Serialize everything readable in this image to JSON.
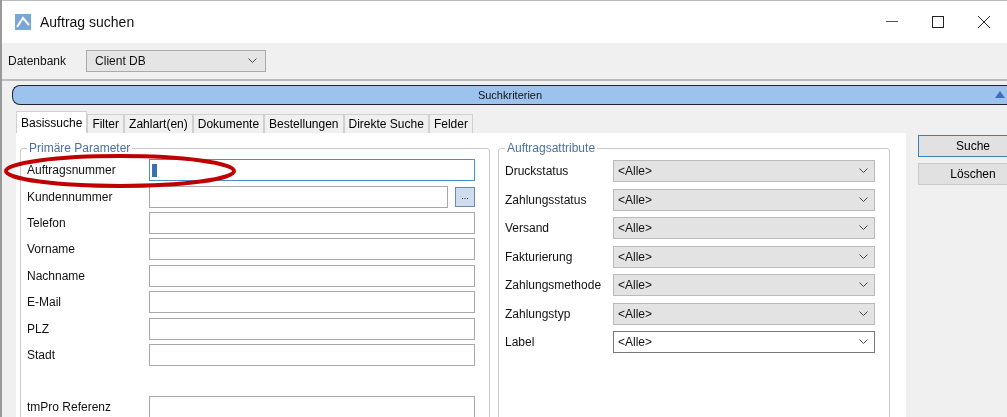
{
  "window": {
    "title": "Auftrag suchen"
  },
  "database": {
    "label": "Datenbank",
    "value": "Client DB"
  },
  "section_bar": {
    "title": "Suchkriterien",
    "expanded": true
  },
  "tabs": [
    {
      "label": "Basissuche",
      "selected": true
    },
    {
      "label": "Filter",
      "selected": false
    },
    {
      "label": "Zahlart(en)",
      "selected": false
    },
    {
      "label": "Dokumente",
      "selected": false
    },
    {
      "label": "Bestellungen",
      "selected": false
    },
    {
      "label": "Direkte Suche",
      "selected": false
    },
    {
      "label": "Felder",
      "selected": false
    }
  ],
  "primary_group": {
    "title": "Primäre Parameter",
    "fields": [
      {
        "label": "Auftragsnummer",
        "focused": true
      },
      {
        "label": "Kundennummer",
        "focused": false,
        "browse_button": "..."
      },
      {
        "label": "Telefon",
        "focused": false
      },
      {
        "label": "Vorname",
        "focused": false
      },
      {
        "label": "Nachname",
        "focused": false
      },
      {
        "label": "E-Mail",
        "focused": false
      },
      {
        "label": "PLZ",
        "focused": false
      },
      {
        "label": "Stadt",
        "focused": false
      },
      {
        "label": "tmPro Referenz",
        "focused": false,
        "spaced": true
      }
    ]
  },
  "attributes_group": {
    "title": "Auftragsattribute",
    "fields": [
      {
        "label": "Druckstatus",
        "value": "<Alle>",
        "disabled": true
      },
      {
        "label": "Zahlungsstatus",
        "value": "<Alle>",
        "disabled": true
      },
      {
        "label": "Versand",
        "value": "<Alle>",
        "disabled": true
      },
      {
        "label": "Fakturierung",
        "value": "<Alle>",
        "disabled": true
      },
      {
        "label": "Zahlungsmethode",
        "value": "<Alle>",
        "disabled": true
      },
      {
        "label": "Zahlungstyp",
        "value": "<Alle>",
        "disabled": true
      },
      {
        "label": "Label",
        "value": "<Alle>",
        "disabled": false
      }
    ]
  },
  "buttons": [
    {
      "label": "Suche",
      "default": true
    },
    {
      "label": "Löschen",
      "default": false
    }
  ]
}
